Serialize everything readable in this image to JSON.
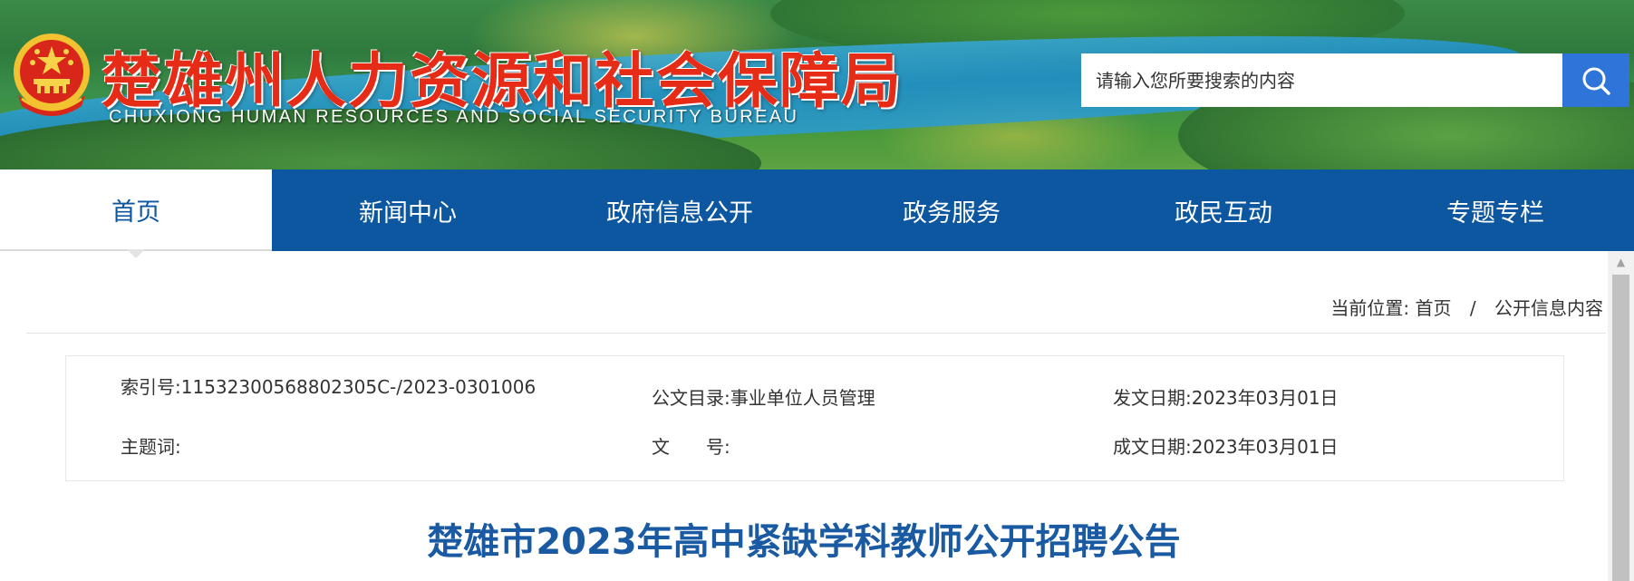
{
  "header": {
    "title": "楚雄州人力资源和社会保障局",
    "subtitle": "CHUXIONG HUMAN RESOURCES AND SOCIAL SECURITY BUREAU",
    "emblem_icon": "national-emblem-icon",
    "search": {
      "placeholder": "请输入您所要搜索的内容",
      "value": "",
      "button_icon": "search-icon"
    }
  },
  "nav": {
    "active_index": 0,
    "items": [
      {
        "label": "首页"
      },
      {
        "label": "新闻中心"
      },
      {
        "label": "政府信息公开"
      },
      {
        "label": "政务服务"
      },
      {
        "label": "政民互动"
      },
      {
        "label": "专题专栏"
      }
    ]
  },
  "breadcrumb": {
    "prefix": "当前位置:",
    "items": [
      "首页",
      "公开信息内容"
    ],
    "separator": "/"
  },
  "meta": {
    "index_no": {
      "label": "索引号:",
      "value": "11532300568802305C-/2023-0301006"
    },
    "category": {
      "label": "公文目录:",
      "value": "事业单位人员管理"
    },
    "publish_date": {
      "label": "发文日期:",
      "value": "2023年03月01日"
    },
    "keywords": {
      "label": "主题词:",
      "value": ""
    },
    "doc_no": {
      "label": "文　　号:",
      "value": ""
    },
    "created_date": {
      "label": "成文日期:",
      "value": "2023年03月01日"
    }
  },
  "article": {
    "title": "楚雄市2023年高中紧缺学科教师公开招聘公告"
  },
  "colors": {
    "nav_bg": "#0d56a0",
    "title_red": "#e62b16",
    "search_button": "#2f74d8",
    "article_title": "#1a5aa2"
  }
}
